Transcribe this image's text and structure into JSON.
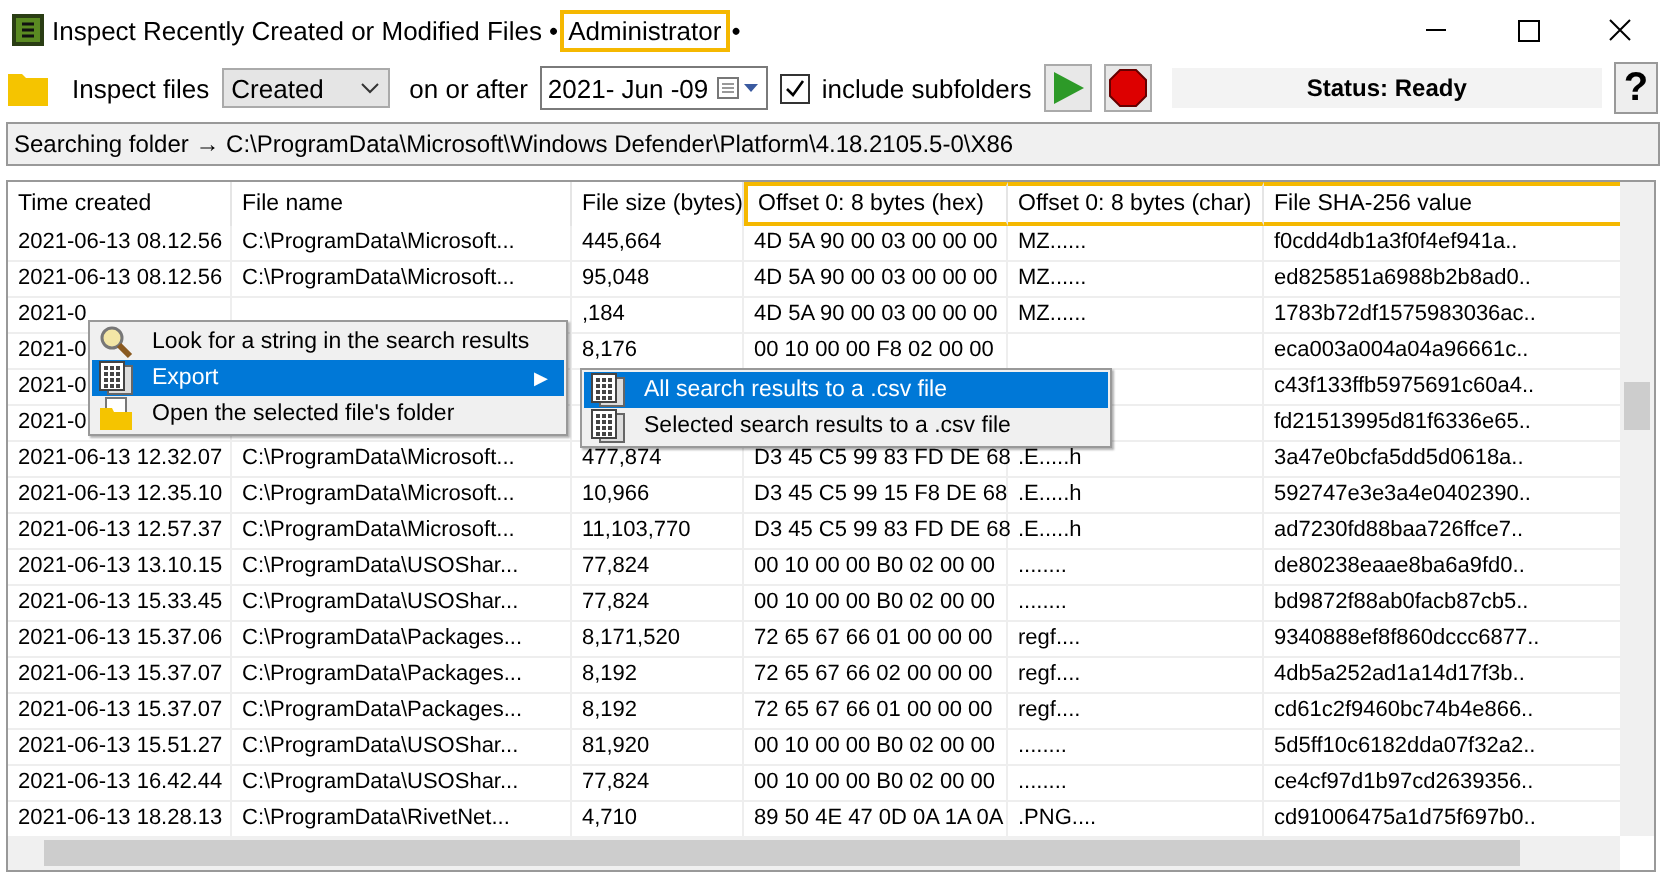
{
  "window": {
    "title": "Inspect Recently Created or Modified Files •",
    "role": {
      "text": "Administrator",
      "highlighted": true
    },
    "title_suffix": "•"
  },
  "toolbar": {
    "inspect_label": "Inspect files",
    "mode": "Created",
    "date_label": "on or after",
    "date": "2021- Jun -09",
    "include_subfolders": {
      "label": "include subfolders",
      "checked": true
    },
    "status": "Status: Ready",
    "help": "?"
  },
  "path_bar": "Searching folder → C:\\ProgramData\\Microsoft\\Windows Defender\\Platform\\4.18.2105.5-0\\X86",
  "table": {
    "columns": [
      {
        "label": "Time created",
        "highlighted": false
      },
      {
        "label": "File name",
        "highlighted": false
      },
      {
        "label": "File size (bytes)",
        "highlighted": false
      },
      {
        "label": "Offset 0: 8 bytes (hex)",
        "highlighted": true
      },
      {
        "label": "Offset 0: 8 bytes (char)",
        "highlighted": true
      },
      {
        "label": "File SHA-256 value",
        "highlighted": true
      }
    ],
    "rows": [
      [
        "2021-06-13 08.12.56",
        "C:\\ProgramData\\Microsoft...",
        "445,664",
        "4D 5A 90 00 03 00 00 00",
        "MZ......",
        "f0cdd4db1a3f0f4ef941a.."
      ],
      [
        "2021-06-13 08.12.56",
        "C:\\ProgramData\\Microsoft...",
        "95,048",
        "4D 5A 90 00 03 00 00 00",
        "MZ......",
        "ed825851a6988b2b8ad0.."
      ],
      [
        "2021-0",
        "",
        ",184",
        "4D 5A 90 00 03 00 00 00",
        "MZ......",
        "1783b72df1575983036ac.."
      ],
      [
        "2021-0",
        "",
        "8,176",
        "00 10 00 00 F8 02 00 00",
        "",
        "eca003a004a04a96661c.."
      ],
      [
        "2021-0",
        "",
        "",
        "",
        "",
        "c43f133ffb5975691c60a4.."
      ],
      [
        "2021-0",
        "",
        "",
        "",
        "",
        "fd21513995d81f6336e65.."
      ],
      [
        "2021-06-13 12.32.07",
        "C:\\ProgramData\\Microsoft...",
        "477,874",
        "D3 45 C5 99 83 FD DE 68",
        ".E.....h",
        "3a47e0bcfa5dd5d0618a.."
      ],
      [
        "2021-06-13 12.35.10",
        "C:\\ProgramData\\Microsoft...",
        "10,966",
        "D3 45 C5 99 15 F8 DE 68",
        ".E.....h",
        "592747e3e3a4e0402390.."
      ],
      [
        "2021-06-13 12.57.37",
        "C:\\ProgramData\\Microsoft...",
        "11,103,770",
        "D3 45 C5 99 83 FD DE 68",
        ".E.....h",
        "ad7230fd88baa726ffce7.."
      ],
      [
        "2021-06-13 13.10.15",
        "C:\\ProgramData\\USOShar...",
        "77,824",
        "00 10 00 00 B0 02 00 00",
        "........",
        "de80238eaae8ba6a9fd0.."
      ],
      [
        "2021-06-13 15.33.45",
        "C:\\ProgramData\\USOShar...",
        "77,824",
        "00 10 00 00 B0 02 00 00",
        "........",
        "bd9872f88ab0facb87cb5.."
      ],
      [
        "2021-06-13 15.37.06",
        "C:\\ProgramData\\Packages...",
        "8,171,520",
        "72 65 67 66 01 00 00 00",
        "regf....",
        "9340888ef8f860dccc6877.."
      ],
      [
        "2021-06-13 15.37.07",
        "C:\\ProgramData\\Packages...",
        "8,192",
        "72 65 67 66 02 00 00 00",
        "regf....",
        "4db5a252ad1a14d17f3b.."
      ],
      [
        "2021-06-13 15.37.07",
        "C:\\ProgramData\\Packages...",
        "8,192",
        "72 65 67 66 01 00 00 00",
        "regf....",
        "cd61c2f9460bc74b4e866.."
      ],
      [
        "2021-06-13 15.51.27",
        "C:\\ProgramData\\USOShar...",
        "81,920",
        "00 10 00 00 B0 02 00 00",
        "........",
        "5d5ff10c6182dda07f32a2.."
      ],
      [
        "2021-06-13 16.42.44",
        "C:\\ProgramData\\USOShar...",
        "77,824",
        "00 10 00 00 B0 02 00 00",
        "........",
        "ce4cf97d1b97cd2639356.."
      ],
      [
        "2021-06-13 18.28.13",
        "C:\\ProgramData\\RivetNet...",
        "4,710",
        "89 50 4E 47 0D 0A 1A 0A",
        ".PNG....",
        "cd91006475a1d75f697b0.."
      ]
    ]
  },
  "context_menu": {
    "items": [
      {
        "label": "Look for a string in the search results",
        "kind": "search",
        "selected": false,
        "has_submenu": false
      },
      {
        "label": "Export",
        "kind": "export",
        "selected": true,
        "has_submenu": true
      },
      {
        "label": "Open the selected file's folder",
        "kind": "folder",
        "selected": false,
        "has_submenu": false
      }
    ],
    "submenu": [
      {
        "label": "All search results to a .csv file",
        "selected": true
      },
      {
        "label": "Selected search results to a .csv file",
        "selected": false
      }
    ],
    "submenu_arrow": "▶"
  }
}
